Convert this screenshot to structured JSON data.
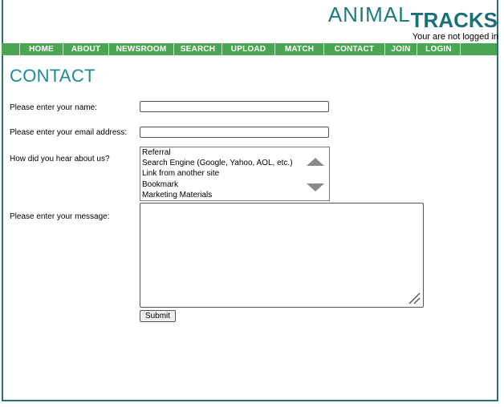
{
  "brand": {
    "logo_part1": "ANIMAL",
    "logo_part2": "TRACKS",
    "accent_color": "#1f7a80"
  },
  "header": {
    "login_status": "Your are not logged in"
  },
  "nav": {
    "background": "#4ca552",
    "items": [
      "HOME",
      "ABOUT",
      "NEWSROOM",
      "SEARCH",
      "UPLOAD",
      "MATCH",
      "CONTACT",
      "JOIN",
      "LOGIN"
    ]
  },
  "page": {
    "title": "CONTACT"
  },
  "form": {
    "name_label": "Please enter your name:",
    "name_value": "",
    "email_label": "Please enter your email address:",
    "email_value": "",
    "hear_label": "How did you hear about us?",
    "hear_options": [
      "Referral",
      "Search Engine (Google, Yahoo, AOL, etc.)",
      "Link from another site",
      "Bookmark",
      "Marketing Materials"
    ],
    "message_label": "Please enter your message:",
    "message_value": "",
    "submit_label": "Submit"
  },
  "icons": [
    "scroll-up-arrow-icon",
    "scroll-down-arrow-icon",
    "resize-grip-icon"
  ]
}
